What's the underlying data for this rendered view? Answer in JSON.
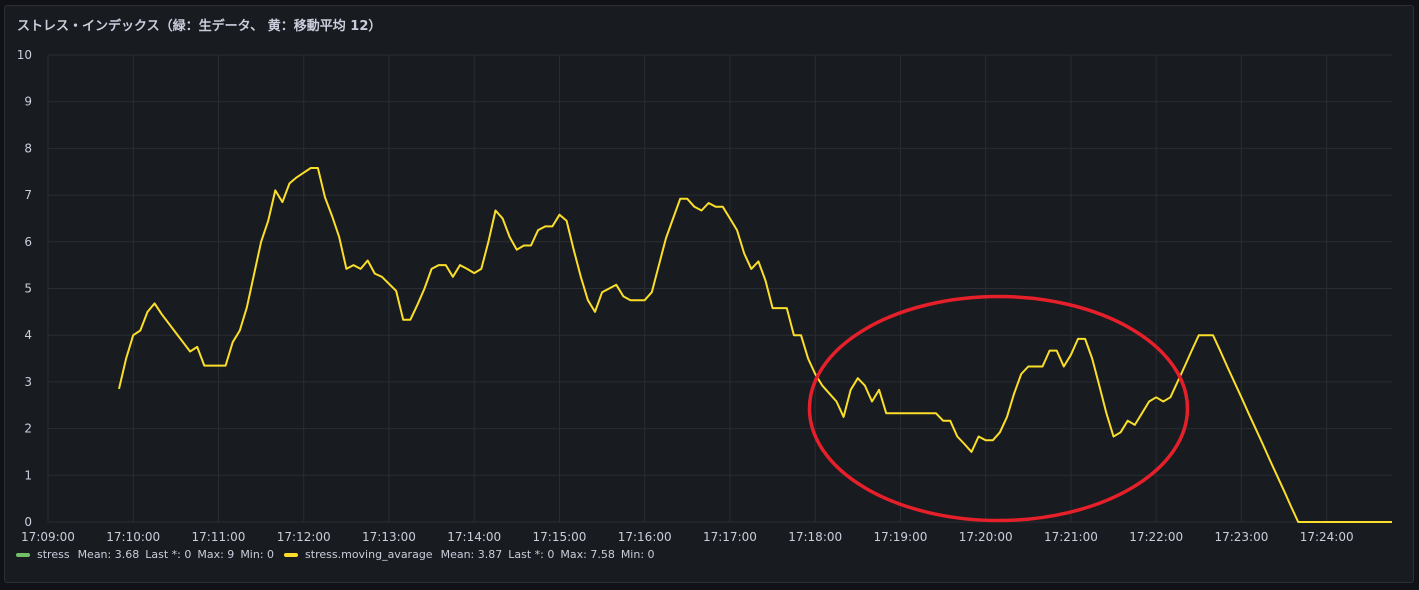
{
  "panel": {
    "title": "ストレス・インデックス（緑：生データ、 黄：移動平均 12）"
  },
  "colors": {
    "moving_average": "#fade2a",
    "stress": "#73bf69",
    "annotation": "#e5202a",
    "grid": "#2a2d33",
    "text": "#ccccdc"
  },
  "legend": [
    {
      "name": "stress",
      "color": "#73bf69",
      "mean": "Mean: 3.68",
      "last": "Last *: 0",
      "max": "Max: 9",
      "min": "Min: 0"
    },
    {
      "name": "stress.moving_avarage",
      "color": "#fade2a",
      "mean": "Mean: 3.87",
      "last": "Last *: 0",
      "max": "Max: 7.58",
      "min": "Min: 0"
    }
  ],
  "chart_data": {
    "type": "line",
    "title": "ストレス・インデックス（緑：生データ、 黄：移動平均 12）",
    "xlabel": "",
    "ylabel": "",
    "ylim": [
      0,
      10
    ],
    "yticks": [
      "0",
      "1",
      "2",
      "3",
      "4",
      "5",
      "6",
      "7",
      "8",
      "9",
      "10"
    ],
    "xticks": [
      "17:09:00",
      "17:10:00",
      "17:11:00",
      "17:12:00",
      "17:13:00",
      "17:14:00",
      "17:15:00",
      "17:16:00",
      "17:17:00",
      "17:18:00",
      "17:19:00",
      "17:20:00",
      "17:21:00",
      "17:22:00",
      "17:23:00",
      "17:24:00"
    ],
    "xlim": [
      "17:09:00",
      "17:24:46"
    ],
    "grid": true,
    "legend_position": "bottom",
    "annotation": "red ellipse around 17:18 – 17:22",
    "series": [
      {
        "name": "stress.moving_avarage",
        "color": "#fade2a",
        "points": [
          [
            "17:09:50",
            2.85
          ],
          [
            "17:09:55",
            3.5
          ],
          [
            "17:10:00",
            4.0
          ],
          [
            "17:10:05",
            4.1
          ],
          [
            "17:10:10",
            4.5
          ],
          [
            "17:10:15",
            4.68
          ],
          [
            "17:10:20",
            4.45
          ],
          [
            "17:10:25",
            4.25
          ],
          [
            "17:10:30",
            4.05
          ],
          [
            "17:10:35",
            3.85
          ],
          [
            "17:10:40",
            3.65
          ],
          [
            "17:10:45",
            3.75
          ],
          [
            "17:10:50",
            3.35
          ],
          [
            "17:10:55",
            3.35
          ],
          [
            "17:11:00",
            3.35
          ],
          [
            "17:11:05",
            3.35
          ],
          [
            "17:11:10",
            3.85
          ],
          [
            "17:11:15",
            4.1
          ],
          [
            "17:11:20",
            4.6
          ],
          [
            "17:11:25",
            5.3
          ],
          [
            "17:11:30",
            6.0
          ],
          [
            "17:11:35",
            6.45
          ],
          [
            "17:11:40",
            7.1
          ],
          [
            "17:11:45",
            6.85
          ],
          [
            "17:11:50",
            7.25
          ],
          [
            "17:11:55",
            7.38
          ],
          [
            "17:12:00",
            7.48
          ],
          [
            "17:12:05",
            7.58
          ],
          [
            "17:12:10",
            7.58
          ],
          [
            "17:12:15",
            6.95
          ],
          [
            "17:12:20",
            6.55
          ],
          [
            "17:12:25",
            6.1
          ],
          [
            "17:12:30",
            5.42
          ],
          [
            "17:12:35",
            5.5
          ],
          [
            "17:12:40",
            5.42
          ],
          [
            "17:12:45",
            5.6
          ],
          [
            "17:12:50",
            5.32
          ],
          [
            "17:12:55",
            5.25
          ],
          [
            "17:13:00",
            5.1
          ],
          [
            "17:13:05",
            4.95
          ],
          [
            "17:13:10",
            4.33
          ],
          [
            "17:13:15",
            4.33
          ],
          [
            "17:13:20",
            4.65
          ],
          [
            "17:13:25",
            5.0
          ],
          [
            "17:13:30",
            5.42
          ],
          [
            "17:13:35",
            5.5
          ],
          [
            "17:13:40",
            5.5
          ],
          [
            "17:13:45",
            5.25
          ],
          [
            "17:13:50",
            5.5
          ],
          [
            "17:13:55",
            5.42
          ],
          [
            "17:14:00",
            5.33
          ],
          [
            "17:14:05",
            5.42
          ],
          [
            "17:14:10",
            6.0
          ],
          [
            "17:14:15",
            6.67
          ],
          [
            "17:14:20",
            6.5
          ],
          [
            "17:14:25",
            6.1
          ],
          [
            "17:14:30",
            5.83
          ],
          [
            "17:14:35",
            5.92
          ],
          [
            "17:14:40",
            5.92
          ],
          [
            "17:14:45",
            6.25
          ],
          [
            "17:14:50",
            6.33
          ],
          [
            "17:14:55",
            6.33
          ],
          [
            "17:15:00",
            6.58
          ],
          [
            "17:15:05",
            6.45
          ],
          [
            "17:15:10",
            5.83
          ],
          [
            "17:15:15",
            5.25
          ],
          [
            "17:15:20",
            4.75
          ],
          [
            "17:15:25",
            4.5
          ],
          [
            "17:15:30",
            4.92
          ],
          [
            "17:15:35",
            5.0
          ],
          [
            "17:15:40",
            5.08
          ],
          [
            "17:15:45",
            4.83
          ],
          [
            "17:15:50",
            4.75
          ],
          [
            "17:15:55",
            4.75
          ],
          [
            "17:16:00",
            4.75
          ],
          [
            "17:16:05",
            4.92
          ],
          [
            "17:16:10",
            5.5
          ],
          [
            "17:16:15",
            6.08
          ],
          [
            "17:16:20",
            6.5
          ],
          [
            "17:16:25",
            6.92
          ],
          [
            "17:16:30",
            6.92
          ],
          [
            "17:16:35",
            6.75
          ],
          [
            "17:16:40",
            6.67
          ],
          [
            "17:16:45",
            6.83
          ],
          [
            "17:16:50",
            6.75
          ],
          [
            "17:16:55",
            6.75
          ],
          [
            "17:17:00",
            6.5
          ],
          [
            "17:17:05",
            6.25
          ],
          [
            "17:17:10",
            5.75
          ],
          [
            "17:17:15",
            5.42
          ],
          [
            "17:17:20",
            5.58
          ],
          [
            "17:17:25",
            5.17
          ],
          [
            "17:17:30",
            4.58
          ],
          [
            "17:17:35",
            4.58
          ],
          [
            "17:17:40",
            4.58
          ],
          [
            "17:17:45",
            4.0
          ],
          [
            "17:17:50",
            4.0
          ],
          [
            "17:17:55",
            3.5
          ],
          [
            "17:18:00",
            3.17
          ],
          [
            "17:18:05",
            2.92
          ],
          [
            "17:18:10",
            2.75
          ],
          [
            "17:18:15",
            2.58
          ],
          [
            "17:18:20",
            2.25
          ],
          [
            "17:18:25",
            2.83
          ],
          [
            "17:18:30",
            3.08
          ],
          [
            "17:18:35",
            2.92
          ],
          [
            "17:18:40",
            2.58
          ],
          [
            "17:18:45",
            2.83
          ],
          [
            "17:18:50",
            2.33
          ],
          [
            "17:18:55",
            2.33
          ],
          [
            "17:19:00",
            2.33
          ],
          [
            "17:19:05",
            2.33
          ],
          [
            "17:19:10",
            2.33
          ],
          [
            "17:19:15",
            2.33
          ],
          [
            "17:19:20",
            2.33
          ],
          [
            "17:19:25",
            2.33
          ],
          [
            "17:19:30",
            2.17
          ],
          [
            "17:19:35",
            2.17
          ],
          [
            "17:19:40",
            1.83
          ],
          [
            "17:19:45",
            1.67
          ],
          [
            "17:19:50",
            1.5
          ],
          [
            "17:19:55",
            1.83
          ],
          [
            "17:20:00",
            1.75
          ],
          [
            "17:20:05",
            1.75
          ],
          [
            "17:20:10",
            1.92
          ],
          [
            "17:20:15",
            2.25
          ],
          [
            "17:20:20",
            2.75
          ],
          [
            "17:20:25",
            3.17
          ],
          [
            "17:20:30",
            3.33
          ],
          [
            "17:20:35",
            3.33
          ],
          [
            "17:20:40",
            3.33
          ],
          [
            "17:20:45",
            3.67
          ],
          [
            "17:20:50",
            3.67
          ],
          [
            "17:20:55",
            3.33
          ],
          [
            "17:21:00",
            3.58
          ],
          [
            "17:21:05",
            3.92
          ],
          [
            "17:21:10",
            3.92
          ],
          [
            "17:21:15",
            3.5
          ],
          [
            "17:21:20",
            2.92
          ],
          [
            "17:21:25",
            2.33
          ],
          [
            "17:21:30",
            1.83
          ],
          [
            "17:21:35",
            1.92
          ],
          [
            "17:21:40",
            2.17
          ],
          [
            "17:21:45",
            2.08
          ],
          [
            "17:21:50",
            2.33
          ],
          [
            "17:21:55",
            2.58
          ],
          [
            "17:22:00",
            2.67
          ],
          [
            "17:22:05",
            2.58
          ],
          [
            "17:22:10",
            2.67
          ],
          [
            "17:22:15",
            3.0
          ],
          [
            "17:22:20",
            3.33
          ],
          [
            "17:22:25",
            3.67
          ],
          [
            "17:22:30",
            4.0
          ],
          [
            "17:22:35",
            4.0
          ],
          [
            "17:22:40",
            4.0
          ],
          [
            "17:22:45",
            3.67
          ],
          [
            "17:22:50",
            3.33
          ],
          [
            "17:22:55",
            3.0
          ],
          [
            "17:23:00",
            2.67
          ],
          [
            "17:23:05",
            2.33
          ],
          [
            "17:23:10",
            2.0
          ],
          [
            "17:23:15",
            1.67
          ],
          [
            "17:23:20",
            1.33
          ],
          [
            "17:23:25",
            1.0
          ],
          [
            "17:23:30",
            0.67
          ],
          [
            "17:23:35",
            0.33
          ],
          [
            "17:23:40",
            0.0
          ],
          [
            "17:24:00",
            0.0
          ],
          [
            "17:24:46",
            0.0
          ]
        ]
      }
    ]
  }
}
